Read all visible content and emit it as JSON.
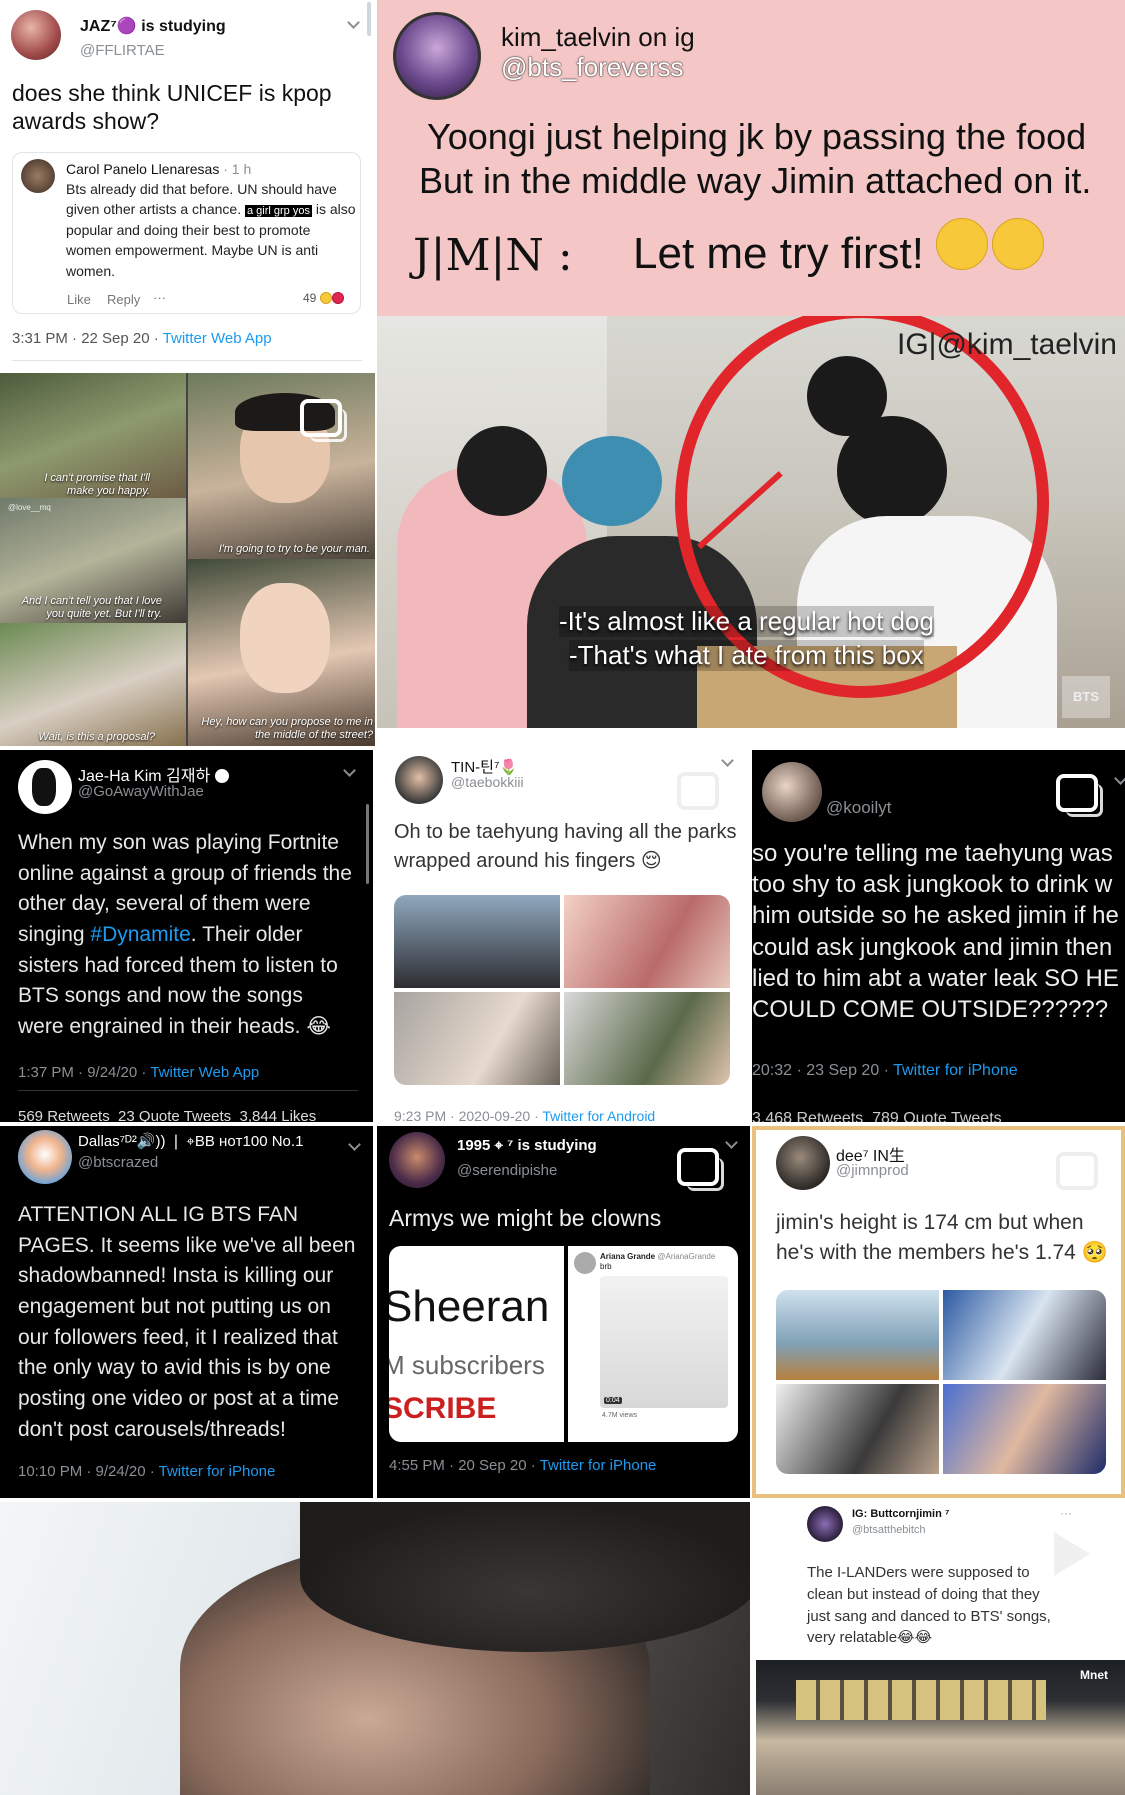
{
  "t1": {
    "name": "JAZ⁷🟣 is studying",
    "handle": "@FFLIRTAE",
    "text": "does she think UNICEF is kpop awards show?",
    "quote": {
      "author": "Carol Panelo Llenaresas",
      "time": "· 1 h",
      "text_a": "Bts already did that before. UN should have given other artists a chance.",
      "highlight": "a girl grp yos",
      "text_b": "is also popular and doing their best to promote women empowerment. Maybe UN is anti women.",
      "like": "Like",
      "reply": "Reply",
      "more": "···",
      "reactions": "49"
    },
    "meta_time": "3:31 PM · 22 Sep 20 · ",
    "meta_app": "Twitter Web App"
  },
  "t2": {
    "name": "kim_taelvin on ig",
    "handle": "@bts_foreverss",
    "line1": "Yoongi just helping jk by passing the food",
    "line2": "But in the middle way Jimin attached on it.",
    "speaker": "J|M|N :",
    "quote": "Let me try first!",
    "watermark": "IG|@kim_taelvin",
    "sub1": "-It's almost like a regular hot dog",
    "sub2": "-That's what I ate from this box",
    "corner": "BTS"
  },
  "t3": {
    "cap1": "I can't promise that I'll make you happy.",
    "cap2": "I'm going to try to be your man.",
    "cap3": "And I can't tell you that I love you quite yet. But I'll try.",
    "cap4": "Wait, is this a proposal?",
    "cap5": "Hey, how can you propose to me in the middle of the street?",
    "small": "@love__mq"
  },
  "t4": {
    "name": "Jae-Ha Kim 김재하",
    "handle": "@GoAwayWithJae",
    "text_a": "When my son was playing Fortnite online against a group of friends the other day, several of them were singing ",
    "tag": "#Dynamite",
    "text_b": ". Their older sisters had forced them to listen to BTS songs and now the songs were engrained in their heads. 😂",
    "meta_time": "1:37 PM · 9/24/20 · ",
    "meta_app": "Twitter Web App",
    "stats": "569 Retweets  23 Quote Tweets  3,844 Likes"
  },
  "t5": {
    "name": "TIN-틴⁷🌷",
    "handle": "@taebokkiii",
    "text": "Oh to be taehyung having all the parks wrapped around his fingers 😌",
    "meta_time": "9:23 PM · 2020-09-20 · ",
    "meta_app": "Twitter for Android"
  },
  "t6": {
    "handle": "@kooilyt",
    "text": "so you're telling me taehyung was too shy to ask jungkook to drink w him outside so he asked jimin if he could ask jungkook and jimin then lied to him abt a water leak SO HE COULD COME OUTSIDE??????",
    "meta_time": "20:32 · 23 Sep 20 · ",
    "meta_app": "Twitter for iPhone",
    "stats": "3,468 Retweets  789 Quote Tweets"
  },
  "t7": {
    "name": "Dallas⁷ᴰ²🔊)) ❘ ⌖BB ʜᴏᴛ100 No.1",
    "handle": "@btscrazed",
    "text": "ATTENTION ALL IG BTS FAN PAGES. It seems like we've all been shadowbanned! Insta is killing our engagement but not putting us on our followers feed, it I realized that the only way to avid this is by one posting one video or post at a time don't post carousels/threads!",
    "meta_time": "10:10 PM · 9/24/20 · ",
    "meta_app": "Twitter for iPhone"
  },
  "t8": {
    "name": "1995 ⌖ ⁷ is studying",
    "handle": "@serendipishe",
    "text": "Armys we might be clowns",
    "yt1": "Sheeran",
    "yt2": "M subscribers",
    "yt3": "SCRIBE",
    "ag_name": "Ariana Grande",
    "ag_handle": "@ArianaGrande",
    "ag_text": "brb",
    "duration": "0:04",
    "views": "4.7M views",
    "meta_time": "4:55 PM · 20 Sep 20 · ",
    "meta_app": "Twitter for iPhone"
  },
  "t9": {
    "name": "dee⁷ IN生",
    "handle": "@jimnprod",
    "text": "jimin's height is 174 cm but when he's with the members he's 1.74 🥺"
  },
  "t10": {
    "name": "IG: Buttcornjimin ⁷",
    "handle": "@btsatthebitch",
    "text": "The I-LANDers were supposed to clean but instead of doing that they just sang and danced to BTS' songs, very relatable😂😂",
    "more": "···",
    "logo": "Mnet"
  },
  "colors": {
    "link": "#1d9bf0",
    "pink": "#f4c7c6",
    "border_gold": "#e9c07c",
    "red_circle": "#e0262a"
  }
}
